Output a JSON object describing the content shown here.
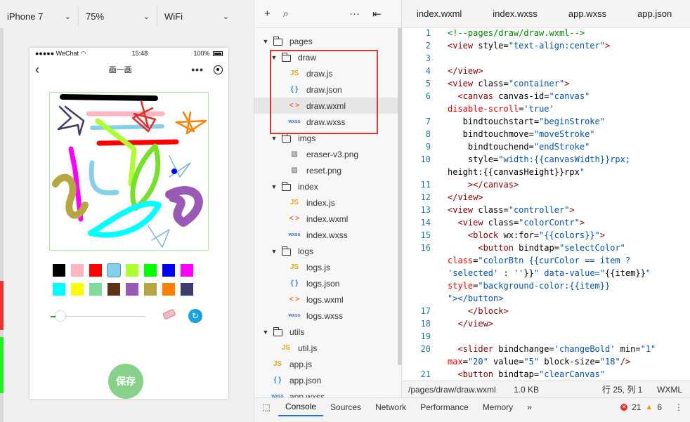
{
  "simulator": {
    "device": "iPhone 7",
    "zoom": "75%",
    "network": "WiFi",
    "status_carrier": "●●●●● WeChat",
    "status_wifi": "WiFi",
    "status_time": "15:48",
    "status_battery": "100%",
    "page_title": "画一画",
    "colors": [
      "#000000",
      "#ffb6c1",
      "#ff0000",
      "#87ceeb",
      "#adff2f",
      "#00ff00",
      "#0000ff",
      "#ff00ff",
      "#00ffff",
      "#ffff00",
      "#7fd99a",
      "#5c3317",
      "#9b59b6",
      "#b5a642",
      "#ff8000",
      "#3d3d6b"
    ],
    "selected_color": "#87ceeb",
    "slider_value": 5,
    "slider_min": 1,
    "slider_max": 20,
    "save_label": "保存"
  },
  "tree": {
    "items": [
      {
        "label": "pages",
        "type": "folder",
        "depth": 0
      },
      {
        "label": "draw",
        "type": "folder",
        "depth": 1
      },
      {
        "label": "draw.js",
        "type": "js",
        "depth": 2
      },
      {
        "label": "draw.json",
        "type": "json",
        "depth": 2
      },
      {
        "label": "draw.wxml",
        "type": "wxml",
        "depth": 2,
        "active": true
      },
      {
        "label": "draw.wxss",
        "type": "wxss",
        "depth": 2
      },
      {
        "label": "imgs",
        "type": "folder",
        "depth": 1
      },
      {
        "label": "eraser-v3.png",
        "type": "img",
        "depth": 2
      },
      {
        "label": "reset.png",
        "type": "img",
        "depth": 2
      },
      {
        "label": "index",
        "type": "folder",
        "depth": 1
      },
      {
        "label": "index.js",
        "type": "js",
        "depth": 2
      },
      {
        "label": "index.wxml",
        "type": "wxml",
        "depth": 2
      },
      {
        "label": "index.wxss",
        "type": "wxss",
        "depth": 2
      },
      {
        "label": "logs",
        "type": "folder",
        "depth": 1
      },
      {
        "label": "logs.js",
        "type": "js",
        "depth": 2
      },
      {
        "label": "logs.json",
        "type": "json",
        "depth": 2
      },
      {
        "label": "logs.wxml",
        "type": "wxml",
        "depth": 2
      },
      {
        "label": "logs.wxss",
        "type": "wxss",
        "depth": 2
      },
      {
        "label": "utils",
        "type": "folder",
        "depth": 0
      },
      {
        "label": "util.js",
        "type": "js",
        "depth": 1
      },
      {
        "label": "app.js",
        "type": "js",
        "depth": 0
      },
      {
        "label": "app.json",
        "type": "json",
        "depth": 0
      },
      {
        "label": "app.wxss",
        "type": "wxss",
        "depth": 0
      }
    ],
    "icon_labels": {
      "js": "JS",
      "json": "{ }",
      "wxml": "< >",
      "wxss": "wxss"
    }
  },
  "editor": {
    "tabs": [
      "index.wxml",
      "index.wxss",
      "app.wxss",
      "app.json"
    ],
    "lines": [
      {
        "n": "1",
        "t": "<!--pages/draw/draw.wxml-->"
      },
      {
        "n": "2",
        "t": "<view style=\"text-align:center\">"
      },
      {
        "n": "3",
        "t": ""
      },
      {
        "n": "4",
        "t": "</view>"
      },
      {
        "n": "5",
        "t": "<view class=\"container\">"
      },
      {
        "n": "6",
        "t": "  <canvas canvas-id=\"canvas\""
      },
      {
        "n": "",
        "t": "disable-scroll='true'"
      },
      {
        "n": "7",
        "t": "   bindtouchstart=\"beginStroke\""
      },
      {
        "n": "8",
        "t": "   bindtouchmove=\"moveStroke\""
      },
      {
        "n": "9",
        "t": "    bindtouchend=\"endStroke\""
      },
      {
        "n": "10",
        "t": "    style=\"width:{{canvasWidth}}rpx;"
      },
      {
        "n": "",
        "t": "height:{{canvasHeight}}rpx\""
      },
      {
        "n": "11",
        "t": "    ></canvas>"
      },
      {
        "n": "12",
        "t": "</view>"
      },
      {
        "n": "13",
        "t": "<view class=\"controller\">"
      },
      {
        "n": "14",
        "t": "  <view class=\"colorContr\">"
      },
      {
        "n": "15",
        "t": "    <block wx:for=\"{{colors}}\">"
      },
      {
        "n": "16",
        "t": "      <button bindtap=\"selectColor\""
      },
      {
        "n": "",
        "t": "class=\"colorBtn {{curColor == item ?"
      },
      {
        "n": "",
        "t": "'selected' : ''}}\" data-value=\"{{item}}\""
      },
      {
        "n": "",
        "t": "style=\"background-color:{{item}}"
      },
      {
        "n": "",
        "t": "\"></button>"
      },
      {
        "n": "17",
        "t": "    </block>"
      },
      {
        "n": "18",
        "t": "  </view>"
      },
      {
        "n": "19",
        "t": ""
      },
      {
        "n": "20",
        "t": "  <slider bindchange='changeBold' min=\"1\""
      },
      {
        "n": "",
        "t": "max=\"20\" value=\"5\" block-size=\"18\"/>"
      },
      {
        "n": "21",
        "t": "  <button bindtap=\"clearCanvas\""
      }
    ],
    "status_path": "/pages/draw/draw.wxml",
    "status_size": "1.0 KB",
    "status_pos": "行 25, 列 1",
    "status_lang": "WXML"
  },
  "devtools": {
    "tabs": [
      "Console",
      "Sources",
      "Network",
      "Performance",
      "Memory"
    ],
    "active_tab": "Console",
    "more": "»",
    "errors": "21",
    "warnings": "6"
  }
}
